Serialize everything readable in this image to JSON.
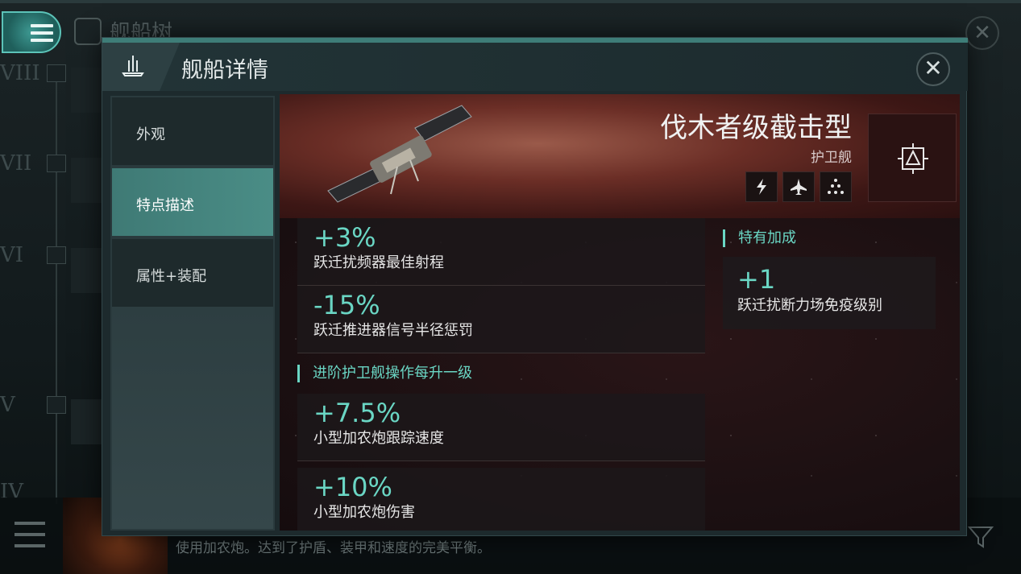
{
  "background": {
    "title": "舰船树",
    "tiers": [
      "VIII",
      "VII",
      "VI",
      "V",
      "IV"
    ],
    "bottom_description": "使用加农炮。达到了护盾、装甲和速度的完美平衡。"
  },
  "modal": {
    "title": "舰船详情",
    "close_label": "✕",
    "sidebar": {
      "items": [
        {
          "label": "外观",
          "active": false
        },
        {
          "label": "特点描述",
          "active": true
        },
        {
          "label": "属性+装配",
          "active": false
        }
      ]
    },
    "ship": {
      "name": "伐木者级截击型",
      "class": "护卫舰",
      "trait_icons": [
        "lightning-icon",
        "fighter-icon",
        "triangle-dots-icon"
      ]
    },
    "bonuses": [
      {
        "value": "+3%",
        "description": "跃迁扰频器最佳射程"
      },
      {
        "value": "-15%",
        "description": "跃迁推进器信号半径惩罚"
      }
    ],
    "skill_section": {
      "header": "进阶护卫舰操作每升一级",
      "bonuses": [
        {
          "value": "+7.5%",
          "description": "小型加农炮跟踪速度"
        },
        {
          "value": "+10%",
          "description": "小型加农炮伤害"
        }
      ]
    },
    "role_section": {
      "header": "特有加成",
      "bonuses": [
        {
          "value": "+1",
          "description": "跃迁扰断力场免疫级别"
        }
      ]
    }
  },
  "colors": {
    "accent": "#6ad6c4",
    "active_tab": "#4a8d86",
    "modal_bg": "#1d2a2d"
  }
}
